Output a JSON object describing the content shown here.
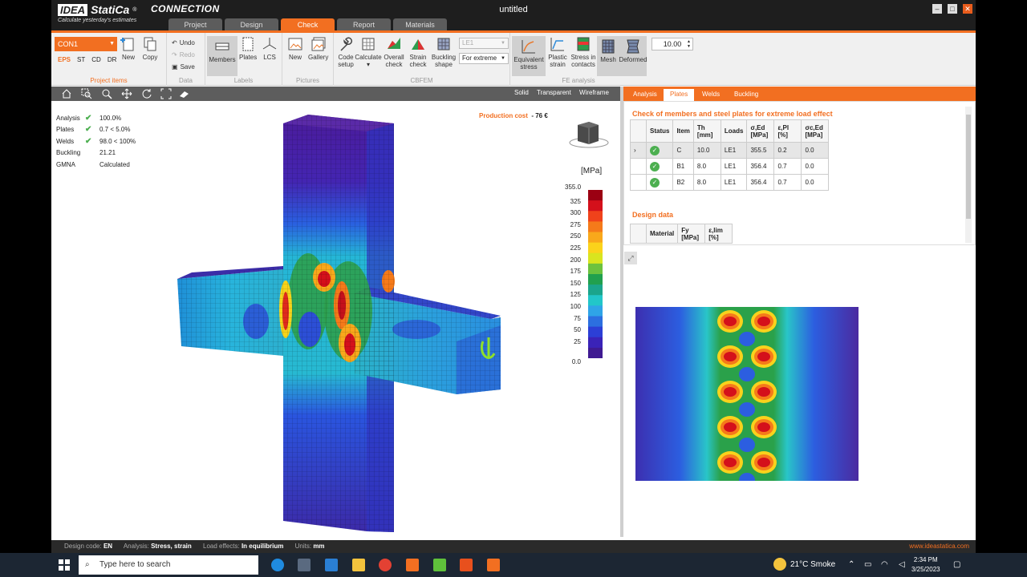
{
  "app": {
    "logo": "IDEA StatiCa",
    "logo_box": "IDEA",
    "logo_word": "StatiCa",
    "logo_reg": "®",
    "product": "CONNECTION",
    "tagline": "Calculate yesterday's estimates",
    "window_title": "untitled"
  },
  "tabs": [
    {
      "label": "Project",
      "active": false
    },
    {
      "label": "Design",
      "active": false
    },
    {
      "label": "Check",
      "active": true
    },
    {
      "label": "Report",
      "active": false
    },
    {
      "label": "Materials",
      "active": false
    }
  ],
  "ribbon": {
    "project_items": {
      "selected": "CON1",
      "sub_tabs": [
        "EPS",
        "ST",
        "CD",
        "DR"
      ],
      "active_sub_tab": "EPS",
      "new_label": "New",
      "copy_label": "Copy",
      "group_label": "Project items"
    },
    "data": {
      "undo": "Undo",
      "redo": "Redo",
      "save": "Save",
      "group_label": "Data"
    },
    "labels": {
      "members": "Members",
      "plates": "Plates",
      "lcs": "LCS",
      "group_label": "Labels"
    },
    "pictures": {
      "new": "New",
      "gallery": "Gallery",
      "group_label": "Pictures"
    },
    "cbfem": {
      "code_setup": "Code setup",
      "calculate": "Calculate",
      "overall_check": "Overall check",
      "strain_check": "Strain check",
      "buckling_shape": "Buckling shape",
      "load_select": "LE1",
      "extreme_select": "For extreme",
      "group_label": "CBFEM"
    },
    "fe_analysis": {
      "equivalent_stress": "Equivalent stress",
      "plastic_strain": "Plastic strain",
      "stress_contacts": "Stress in contacts",
      "mesh": "Mesh",
      "deformed": "Deformed",
      "scale_value": "10.00",
      "group_label": "FE analysis"
    }
  },
  "view_modes": [
    "Solid",
    "Transparent",
    "Wireframe"
  ],
  "summary": [
    {
      "label": "Analysis",
      "ok": true,
      "value": "100.0%"
    },
    {
      "label": "Plates",
      "ok": true,
      "value": "0.7 < 5.0%"
    },
    {
      "label": "Welds",
      "ok": true,
      "value": "98.0 < 100%"
    },
    {
      "label": "Buckling",
      "ok": false,
      "value": "21.21"
    },
    {
      "label": "GMNA",
      "ok": false,
      "value": "Calculated"
    }
  ],
  "production_cost": {
    "label": "Production cost",
    "value": "76 €"
  },
  "legend": {
    "unit": "[MPa]",
    "max": "355.0",
    "ticks": [
      "325",
      "300",
      "275",
      "250",
      "225",
      "200",
      "175",
      "150",
      "125",
      "100",
      "75",
      "50",
      "25"
    ],
    "min": "0.0",
    "colors": [
      "#9b0012",
      "#d4101b",
      "#f0421b",
      "#f57a1a",
      "#f9a81b",
      "#fbd31b",
      "#d9e51f",
      "#6cc23e",
      "#21a04e",
      "#1ba58c",
      "#22c6c9",
      "#2fa4e7",
      "#2c6fe0",
      "#2c3fd6",
      "#3a23b8",
      "#3f1a92"
    ]
  },
  "right_panel": {
    "tabs": [
      {
        "label": "Analysis",
        "active": false
      },
      {
        "label": "Plates",
        "active": true
      },
      {
        "label": "Welds",
        "active": false
      },
      {
        "label": "Buckling",
        "active": false
      }
    ],
    "title": "Check of members and steel plates for extreme load effect",
    "columns": [
      "Status",
      "Item",
      "Th [mm]",
      "Loads",
      "σ,Ed [MPa]",
      "ε,Pl [%]",
      "σc,Ed [MPa]"
    ],
    "rows": [
      {
        "item": "C",
        "th": "10.0",
        "loads": "LE1",
        "sigma": "355.5",
        "eps": "0.2",
        "sigc": "0.0",
        "selected": true
      },
      {
        "item": "B1",
        "th": "8.0",
        "loads": "LE1",
        "sigma": "356.4",
        "eps": "0.7",
        "sigc": "0.0",
        "selected": false
      },
      {
        "item": "B2",
        "th": "8.0",
        "loads": "LE1",
        "sigma": "356.4",
        "eps": "0.7",
        "sigc": "0.0",
        "selected": false
      }
    ],
    "design_data_title": "Design data",
    "design_columns": [
      "Material",
      "Fy [MPa]",
      "ε,lim [%]"
    ]
  },
  "status_bar": {
    "design_code_label": "Design code:",
    "design_code": "EN",
    "analysis_label": "Analysis:",
    "analysis": "Stress, strain",
    "load_effects_label": "Load effects:",
    "load_effects": "In equilibrium",
    "units_label": "Units:",
    "units": "mm",
    "website": "www.ideastatica.com"
  },
  "taskbar": {
    "search_placeholder": "Type here to search",
    "weather": "21°C  Smoke",
    "time": "2:34 PM",
    "date": "3/25/2023"
  }
}
